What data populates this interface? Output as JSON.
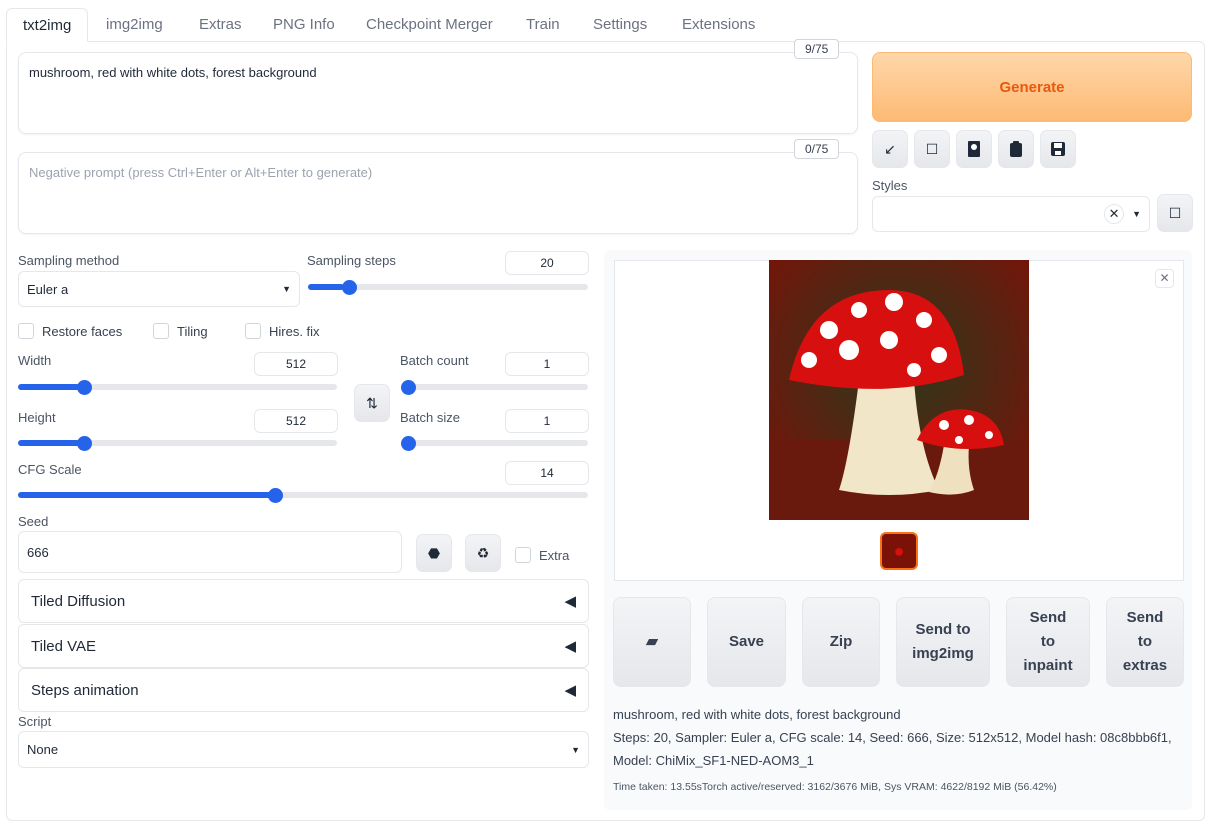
{
  "tabs": [
    "txt2img",
    "img2img",
    "Extras",
    "PNG Info",
    "Checkpoint Merger",
    "Train",
    "Settings",
    "Extensions"
  ],
  "prompt": {
    "value": "mushroom, red with white dots, forest background",
    "counter": "9/75"
  },
  "negative_prompt": {
    "placeholder": "Negative prompt (press Ctrl+Enter or Alt+Enter to generate)",
    "counter": "0/75"
  },
  "generate_label": "Generate",
  "toolbar_icons": [
    "arrow-down-left-icon",
    "square-icon",
    "image-card-icon",
    "clipboard-icon",
    "floppy-disk-icon"
  ],
  "styles": {
    "label": "Styles",
    "value": ""
  },
  "sampling": {
    "method_label": "Sampling method",
    "method": "Euler a",
    "steps_label": "Sampling steps",
    "steps": "20",
    "steps_fraction": 0.128
  },
  "checkboxes": {
    "restore_faces": "Restore faces",
    "tiling": "Tiling",
    "hires": "Hires. fix"
  },
  "width": {
    "label": "Width",
    "value": "512",
    "fraction": 0.195
  },
  "height": {
    "label": "Height",
    "value": "512",
    "fraction": 0.195
  },
  "batch_count": {
    "label": "Batch count",
    "value": "1",
    "fraction": 0
  },
  "batch_size": {
    "label": "Batch size",
    "value": "1",
    "fraction": 0
  },
  "cfg": {
    "label": "CFG Scale",
    "value": "14",
    "fraction": 0.45
  },
  "seed": {
    "label": "Seed",
    "value": "666",
    "extra": "Extra"
  },
  "accordions": [
    "Tiled Diffusion",
    "Tiled VAE",
    "Steps animation"
  ],
  "script": {
    "label": "Script",
    "value": "None"
  },
  "actions": {
    "folder": "folder-icon",
    "save": "Save",
    "zip": "Zip",
    "img2img": "Send to img2img",
    "inpaint": "Send to inpaint",
    "extras": "Send to extras"
  },
  "output": {
    "prompt": "mushroom, red with white dots, forest background",
    "params": "Steps: 20, Sampler: Euler a, CFG scale: 14, Seed: 666, Size: 512x512, Model hash: 08c8bbb6f1,",
    "model": "Model: ChiMix_SF1-NED-AOM3_1",
    "timing": "Time taken: 13.55sTorch active/reserved: 3162/3676 MiB, Sys VRAM: 4622/8192 MiB (56.42%)"
  }
}
